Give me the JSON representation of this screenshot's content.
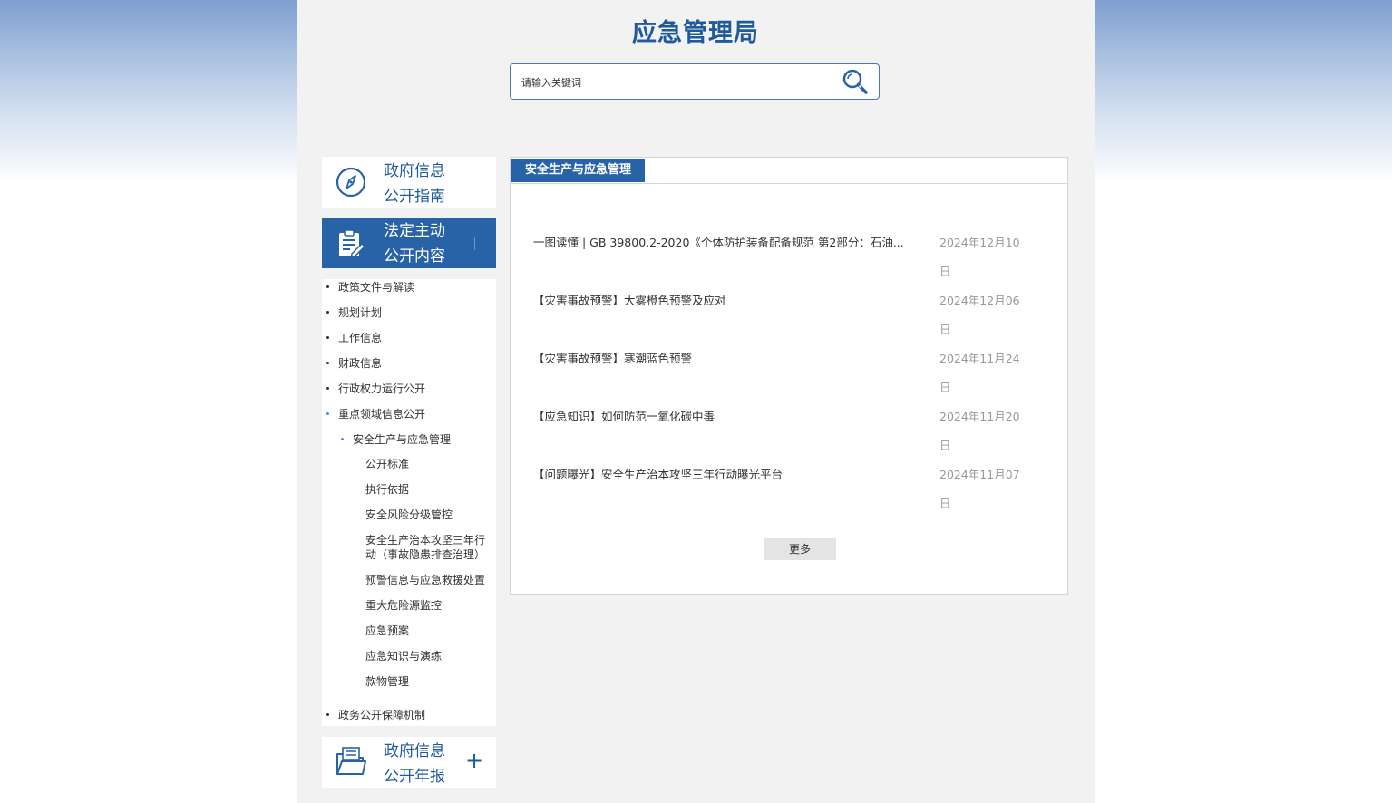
{
  "header": {
    "site_title": "应急管理局",
    "search_placeholder": "请输入关键词"
  },
  "sidebar": {
    "guide_card": {
      "line1": "政府信息",
      "line2": "公开指南",
      "icon": "compass-icon"
    },
    "active_card": {
      "line1": "法定主动",
      "line2": "公开内容",
      "icon": "clipboard-edit-icon"
    },
    "nav_items": [
      "政策文件与解读",
      "规划计划",
      "工作信息",
      "财政信息",
      "行政权力运行公开",
      "重点领域信息公开"
    ],
    "sub_category": "安全生产与应急管理",
    "sub_items": [
      "公开标准",
      "执行依据",
      "安全风险分级管控",
      "安全生产治本攻坚三年行动（事故隐患排查治理）",
      "预警信息与应急救援处置",
      "重大危险源监控",
      "应急预案",
      "应急知识与演练",
      "款物管理"
    ],
    "last_item": "政务公开保障机制",
    "report_card": {
      "line1": "政府信息",
      "line2": "公开年报",
      "icon": "folder-document-icon",
      "expand": "+"
    }
  },
  "main": {
    "tab_label": "安全生产与应急管理",
    "news": [
      {
        "title": "一图读懂 | GB 39800.2-2020《个体防护装备配备规范 第2部分：石油...",
        "date": "2024年12月10日"
      },
      {
        "title": "【灾害事故预警】大雾橙色预警及应对",
        "date": "2024年12月06日"
      },
      {
        "title": "【灾害事故预警】寒潮蓝色预警",
        "date": "2024年11月24日"
      },
      {
        "title": "【应急知识】如何防范一氧化碳中毒",
        "date": "2024年11月20日"
      },
      {
        "title": "【问题曝光】安全生产治本攻坚三年行动曝光平台",
        "date": "2024年11月07日"
      }
    ],
    "more_label": "更多"
  },
  "colors": {
    "brand_blue": "#2863a8",
    "title_blue": "#1f5a9e",
    "bullet_blue": "#4a90d9"
  }
}
